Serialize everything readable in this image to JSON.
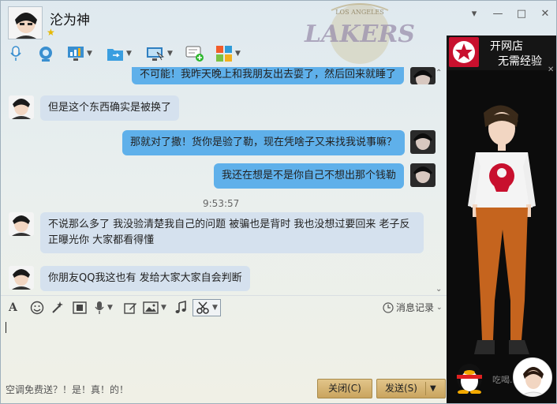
{
  "header": {
    "contact_name": "沦为神",
    "star": "★",
    "window_buttons": {
      "menu": "▾",
      "minimize": "—",
      "maximize": "□",
      "close": "✕"
    }
  },
  "toolbar": {
    "items": [
      {
        "icon": "microphone-icon"
      },
      {
        "icon": "webcam-icon"
      },
      {
        "icon": "screen-share-icon"
      },
      {
        "icon": "file-transfer-icon"
      },
      {
        "icon": "remote-assist-icon"
      },
      {
        "icon": "create-group-icon"
      },
      {
        "icon": "apps-icon"
      }
    ]
  },
  "chat": {
    "messages": [
      {
        "dir": "out",
        "text": "不可能！我昨天晚上和我朋友出去耍了，然后回来就睡了"
      },
      {
        "dir": "in",
        "text": "但是这个东西确实是被换了"
      },
      {
        "dir": "out",
        "text": "那就对了撒！货你是验了勒，现在凭啥子又来找我说事嘛？"
      },
      {
        "dir": "out",
        "text": "我还在想是不是你自己不想出那个钱勒"
      },
      {
        "dir": "in",
        "text": "不说那么多了 我没验清楚我自己的问题 被骗也是背时 我也没想过要回来 老子反正曝光你 大家都看得懂"
      },
      {
        "dir": "in",
        "text": "你朋友QQ我这也有 发给大家大家自会判断"
      }
    ],
    "timestamp": "9:53:57"
  },
  "format_bar": {
    "history_label": "消息记录"
  },
  "input": {
    "value": ""
  },
  "bottom": {
    "promo": "空调免费送？！是！真！的！",
    "close_label": "关闭(C)",
    "send_label": "发送(S)"
  },
  "sidepanel": {
    "ad_line1": "开网店",
    "ad_line2": "无需经验",
    "watermark": "吃喝..."
  },
  "colors": {
    "outgoing_bubble": "#5fb0ea",
    "incoming_bubble": "#d5e1ee",
    "action_button": "#d4b06e"
  }
}
